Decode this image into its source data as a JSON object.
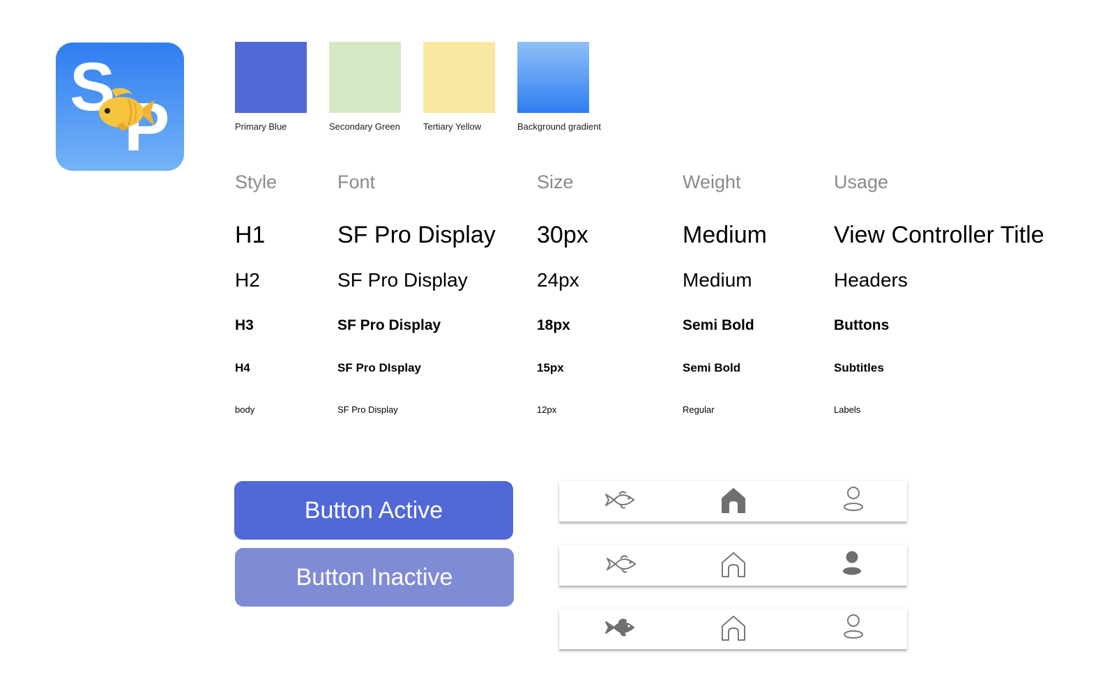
{
  "logo": {
    "letter_s": "S",
    "letter_p": "P",
    "icon": "fish-icon"
  },
  "colors": {
    "swatches": [
      {
        "label": "Primary Blue",
        "color": "#5168d7"
      },
      {
        "label": "Secondary Green",
        "color": "#d7e8c6"
      },
      {
        "label": "Tertiary Yellow",
        "color": "#fae8a1"
      },
      {
        "label": "Background gradient",
        "color_top": "#8fc0f8",
        "color_bottom": "#2f7df0"
      }
    ]
  },
  "typography": {
    "headers": [
      "Style",
      "Font",
      "Size",
      "Weight",
      "Usage"
    ],
    "rows": [
      {
        "style": "H1",
        "font": "SF Pro Display",
        "size": "30px",
        "weight": "Medium",
        "usage": "View Controller Title"
      },
      {
        "style": "H2",
        "font": "SF Pro Display",
        "size": "24px",
        "weight": "Medium",
        "usage": "Headers"
      },
      {
        "style": "H3",
        "font": "SF Pro Display",
        "size": "18px",
        "weight": "Semi Bold",
        "usage": "Buttons"
      },
      {
        "style": "H4",
        "font": "SF Pro DIsplay",
        "size": "15px",
        "weight": "Semi Bold",
        "usage": "Subtitles"
      },
      {
        "style": "body",
        "font": "SF Pro Display",
        "size": "12px",
        "weight": "Regular",
        "usage": "Labels"
      }
    ]
  },
  "buttons": {
    "active_label": "Button Active",
    "inactive_label": "Button Inactive",
    "active_color": "#5168d7",
    "inactive_color": "#7f8bd5"
  },
  "tabbars": [
    {
      "selected": "home",
      "icons": [
        "fish-icon",
        "home-icon",
        "profile-icon"
      ]
    },
    {
      "selected": "profile",
      "icons": [
        "fish-icon",
        "home-icon",
        "profile-icon"
      ]
    },
    {
      "selected": "fish",
      "icons": [
        "fish-icon",
        "home-icon",
        "profile-icon"
      ]
    }
  ]
}
